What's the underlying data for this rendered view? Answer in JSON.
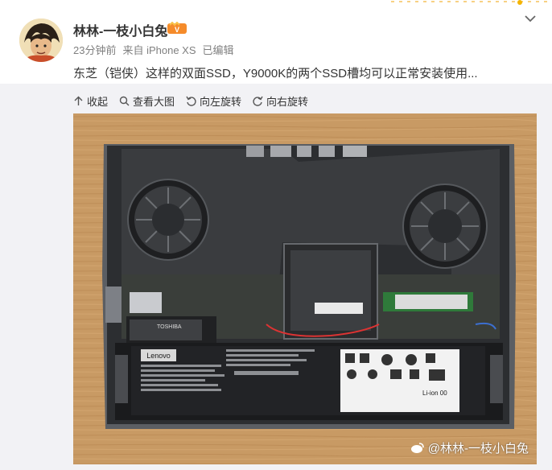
{
  "user": {
    "name": "林林-一枝小白兔",
    "time": "23分钟前",
    "source": "来自 iPhone XS",
    "edited": "已编辑"
  },
  "post": {
    "text": "东芝（铠侠）这样的双面SSD，Y9000K的两个SSD槽均可以正常安装使用..."
  },
  "toolbar": {
    "collapse": "收起",
    "view_large": "查看大图",
    "rotate_left": "向左旋转",
    "rotate_right": "向右旋转"
  },
  "photo": {
    "brand": "Lenovo",
    "ssd_label": "TOSHIBA",
    "battery_type": "Li-ion 00",
    "watermark": "@林林-一枝小白兔"
  },
  "colors": {
    "accent": "#e47c2b",
    "text_primary": "#333333",
    "text_secondary": "#808080",
    "band": "#f2f2f5"
  }
}
